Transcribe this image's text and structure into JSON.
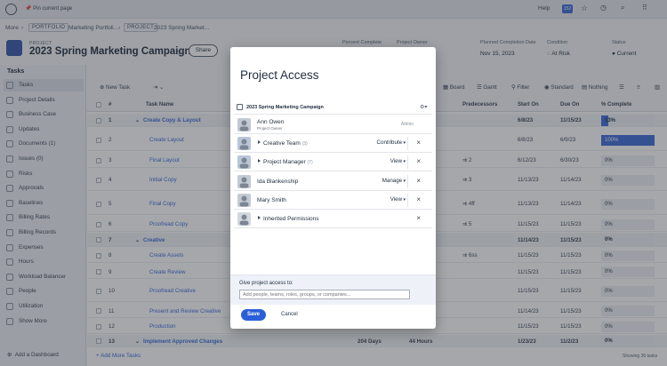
{
  "topbar": {
    "pin_label": "Pin current page",
    "help": "Help",
    "badge": "152"
  },
  "breadcrumb": {
    "more": "More",
    "portfolio_tag": "PORTFOLIO",
    "portfolio_name": "Marketing Portfoli...",
    "project_tag": "PROJECT",
    "project_name": "2023 Spring Market..."
  },
  "header": {
    "label": "PROJECT",
    "title": "2023 Spring Marketing Campaign",
    "share": "Share",
    "percent_label": "Percent Complete",
    "owner_label": "Project Owner",
    "planned_label": "Planned Completion Date",
    "planned_value": "Nov 15, 2023",
    "condition_label": "Condition",
    "condition_value": "At Risk",
    "status_label": "Status",
    "status_value": "Current"
  },
  "sidebar": {
    "title": "Tasks",
    "items": [
      "Tasks",
      "Project Details",
      "Business Case",
      "Updates",
      "Documents (1)",
      "Issues (0)",
      "Risks",
      "Approvals",
      "Baselines",
      "Billing Rates",
      "Billing Records",
      "Expenses",
      "Hours",
      "Workload Balancer",
      "People",
      "Utilization",
      "Show More"
    ],
    "add_dashboard": "Add a Dashboard"
  },
  "toolbar": {
    "new_task": "New Task",
    "board": "Board",
    "gantt": "Gantt",
    "filter": "Filter",
    "standard": "Standard",
    "nothing": "Nothing"
  },
  "grid": {
    "headers": {
      "num": "#",
      "name": "Task Name",
      "pred": "Predecessors",
      "start": "Start On",
      "due": "Due On",
      "pct": "% Complete"
    },
    "rows": [
      {
        "n": "1",
        "name": "Create Copy & Layout",
        "group": true,
        "pred": "",
        "start": "6/8/23",
        "due": "11/15/23",
        "pct": "13%",
        "fill": 0.13
      },
      {
        "n": "2",
        "name": "Create Layout",
        "group": false,
        "pred": "",
        "start": "6/8/23",
        "due": "6/9/23",
        "pct": "100%",
        "fill": 1
      },
      {
        "n": "3",
        "name": "Final Layout",
        "group": false,
        "pred": "2",
        "start": "6/12/23",
        "due": "6/30/23",
        "pct": "0%",
        "fill": 0
      },
      {
        "n": "4",
        "name": "Initial Copy",
        "group": false,
        "pred": "3",
        "start": "11/13/23",
        "due": "11/14/23",
        "pct": "0%",
        "fill": 0
      },
      {
        "n": "5",
        "name": "Final Copy",
        "group": false,
        "pred": "4ff",
        "start": "11/13/23",
        "due": "11/14/23",
        "pct": "0%",
        "fill": 0
      },
      {
        "n": "6",
        "name": "Proofread Copy",
        "group": false,
        "pred": "5",
        "start": "11/15/23",
        "due": "11/15/23",
        "pct": "0%",
        "fill": 0
      },
      {
        "n": "7",
        "name": "Creative",
        "group": true,
        "pred": "",
        "start": "11/14/23",
        "due": "11/15/23",
        "pct": "0%",
        "fill": 0
      },
      {
        "n": "8",
        "name": "Create Assets",
        "group": false,
        "pred": "6ss",
        "start": "11/15/23",
        "due": "11/15/23",
        "pct": "0%",
        "fill": 0
      },
      {
        "n": "9",
        "name": "Create Review",
        "group": false,
        "pred": "",
        "start": "11/15/23",
        "due": "11/15/23",
        "pct": "0%",
        "fill": 0
      },
      {
        "n": "10",
        "name": "Proofread Creative",
        "group": false,
        "pred": "",
        "start": "11/15/23",
        "due": "11/15/23",
        "pct": "0%",
        "fill": 0
      },
      {
        "n": "11",
        "name": "Present and Review Creative",
        "group": false,
        "pred": "",
        "start": "11/14/23",
        "due": "11/15/23",
        "pct": "0%",
        "fill": 0
      },
      {
        "n": "12",
        "name": "Production",
        "group": false,
        "pred": "",
        "start": "11/15/23",
        "due": "11/15/23",
        "pct": "0%",
        "fill": 0
      },
      {
        "n": "13",
        "name": "Implement Approved Changes",
        "group": true,
        "pred": "",
        "start": "1/23/23",
        "due": "11/2/23",
        "pct": "0%",
        "fill": 0,
        "days": "204 Days",
        "hours": "44 Hours"
      }
    ],
    "add_more": "+ Add More Tasks",
    "showing": "Showing 36 tasks"
  },
  "modal": {
    "title": "Project Access",
    "object_name": "2023 Spring Marketing Campaign",
    "entries": [
      {
        "name": "Ann Owen",
        "sub": "Project Owner",
        "role": "Admin",
        "removable": false,
        "expandable": false,
        "count": ""
      },
      {
        "name": "Creative Team",
        "sub": "",
        "role": "Contribute",
        "removable": true,
        "expandable": true,
        "count": "(3)"
      },
      {
        "name": "Project Manager",
        "sub": "",
        "role": "View",
        "removable": true,
        "expandable": true,
        "count": "(7)"
      },
      {
        "name": "Ida Blankenship",
        "sub": "",
        "role": "Manage",
        "removable": true,
        "expandable": false,
        "count": ""
      },
      {
        "name": "Mary Smith",
        "sub": "",
        "role": "View",
        "removable": true,
        "expandable": false,
        "count": ""
      },
      {
        "name": "Inherited Permissions",
        "sub": "",
        "role": "",
        "removable": true,
        "expandable": true,
        "count": ""
      }
    ],
    "give_access_label": "Give project access to:",
    "input_placeholder": "Add people, teams, roles, groups, or companies...",
    "save": "Save",
    "cancel": "Cancel"
  }
}
